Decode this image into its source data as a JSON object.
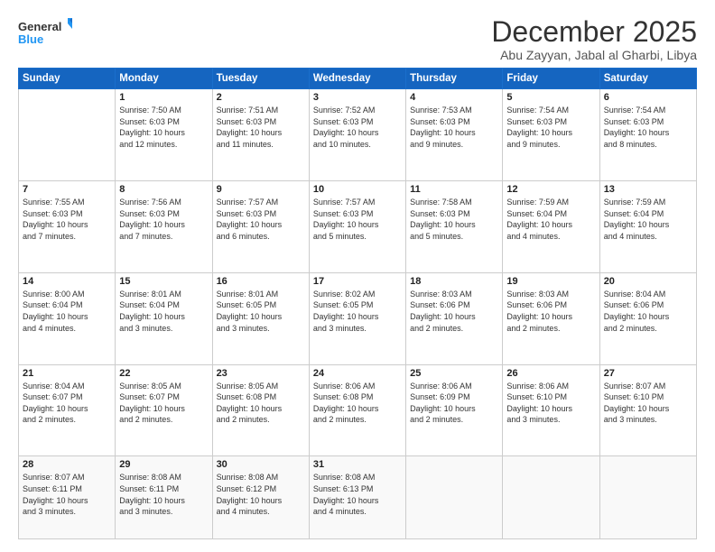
{
  "logo": {
    "line1": "General",
    "line2": "Blue"
  },
  "title": "December 2025",
  "location": "Abu Zayyan, Jabal al Gharbi, Libya",
  "days_header": [
    "Sunday",
    "Monday",
    "Tuesday",
    "Wednesday",
    "Thursday",
    "Friday",
    "Saturday"
  ],
  "weeks": [
    [
      {
        "day": "",
        "content": ""
      },
      {
        "day": "1",
        "content": "Sunrise: 7:50 AM\nSunset: 6:03 PM\nDaylight: 10 hours\nand 12 minutes."
      },
      {
        "day": "2",
        "content": "Sunrise: 7:51 AM\nSunset: 6:03 PM\nDaylight: 10 hours\nand 11 minutes."
      },
      {
        "day": "3",
        "content": "Sunrise: 7:52 AM\nSunset: 6:03 PM\nDaylight: 10 hours\nand 10 minutes."
      },
      {
        "day": "4",
        "content": "Sunrise: 7:53 AM\nSunset: 6:03 PM\nDaylight: 10 hours\nand 9 minutes."
      },
      {
        "day": "5",
        "content": "Sunrise: 7:54 AM\nSunset: 6:03 PM\nDaylight: 10 hours\nand 9 minutes."
      },
      {
        "day": "6",
        "content": "Sunrise: 7:54 AM\nSunset: 6:03 PM\nDaylight: 10 hours\nand 8 minutes."
      }
    ],
    [
      {
        "day": "7",
        "content": "Sunrise: 7:55 AM\nSunset: 6:03 PM\nDaylight: 10 hours\nand 7 minutes."
      },
      {
        "day": "8",
        "content": "Sunrise: 7:56 AM\nSunset: 6:03 PM\nDaylight: 10 hours\nand 7 minutes."
      },
      {
        "day": "9",
        "content": "Sunrise: 7:57 AM\nSunset: 6:03 PM\nDaylight: 10 hours\nand 6 minutes."
      },
      {
        "day": "10",
        "content": "Sunrise: 7:57 AM\nSunset: 6:03 PM\nDaylight: 10 hours\nand 5 minutes."
      },
      {
        "day": "11",
        "content": "Sunrise: 7:58 AM\nSunset: 6:03 PM\nDaylight: 10 hours\nand 5 minutes."
      },
      {
        "day": "12",
        "content": "Sunrise: 7:59 AM\nSunset: 6:04 PM\nDaylight: 10 hours\nand 4 minutes."
      },
      {
        "day": "13",
        "content": "Sunrise: 7:59 AM\nSunset: 6:04 PM\nDaylight: 10 hours\nand 4 minutes."
      }
    ],
    [
      {
        "day": "14",
        "content": "Sunrise: 8:00 AM\nSunset: 6:04 PM\nDaylight: 10 hours\nand 4 minutes."
      },
      {
        "day": "15",
        "content": "Sunrise: 8:01 AM\nSunset: 6:04 PM\nDaylight: 10 hours\nand 3 minutes."
      },
      {
        "day": "16",
        "content": "Sunrise: 8:01 AM\nSunset: 6:05 PM\nDaylight: 10 hours\nand 3 minutes."
      },
      {
        "day": "17",
        "content": "Sunrise: 8:02 AM\nSunset: 6:05 PM\nDaylight: 10 hours\nand 3 minutes."
      },
      {
        "day": "18",
        "content": "Sunrise: 8:03 AM\nSunset: 6:06 PM\nDaylight: 10 hours\nand 2 minutes."
      },
      {
        "day": "19",
        "content": "Sunrise: 8:03 AM\nSunset: 6:06 PM\nDaylight: 10 hours\nand 2 minutes."
      },
      {
        "day": "20",
        "content": "Sunrise: 8:04 AM\nSunset: 6:06 PM\nDaylight: 10 hours\nand 2 minutes."
      }
    ],
    [
      {
        "day": "21",
        "content": "Sunrise: 8:04 AM\nSunset: 6:07 PM\nDaylight: 10 hours\nand 2 minutes."
      },
      {
        "day": "22",
        "content": "Sunrise: 8:05 AM\nSunset: 6:07 PM\nDaylight: 10 hours\nand 2 minutes."
      },
      {
        "day": "23",
        "content": "Sunrise: 8:05 AM\nSunset: 6:08 PM\nDaylight: 10 hours\nand 2 minutes."
      },
      {
        "day": "24",
        "content": "Sunrise: 8:06 AM\nSunset: 6:08 PM\nDaylight: 10 hours\nand 2 minutes."
      },
      {
        "day": "25",
        "content": "Sunrise: 8:06 AM\nSunset: 6:09 PM\nDaylight: 10 hours\nand 2 minutes."
      },
      {
        "day": "26",
        "content": "Sunrise: 8:06 AM\nSunset: 6:10 PM\nDaylight: 10 hours\nand 3 minutes."
      },
      {
        "day": "27",
        "content": "Sunrise: 8:07 AM\nSunset: 6:10 PM\nDaylight: 10 hours\nand 3 minutes."
      }
    ],
    [
      {
        "day": "28",
        "content": "Sunrise: 8:07 AM\nSunset: 6:11 PM\nDaylight: 10 hours\nand 3 minutes."
      },
      {
        "day": "29",
        "content": "Sunrise: 8:08 AM\nSunset: 6:11 PM\nDaylight: 10 hours\nand 3 minutes."
      },
      {
        "day": "30",
        "content": "Sunrise: 8:08 AM\nSunset: 6:12 PM\nDaylight: 10 hours\nand 4 minutes."
      },
      {
        "day": "31",
        "content": "Sunrise: 8:08 AM\nSunset: 6:13 PM\nDaylight: 10 hours\nand 4 minutes."
      },
      {
        "day": "",
        "content": ""
      },
      {
        "day": "",
        "content": ""
      },
      {
        "day": "",
        "content": ""
      }
    ]
  ]
}
